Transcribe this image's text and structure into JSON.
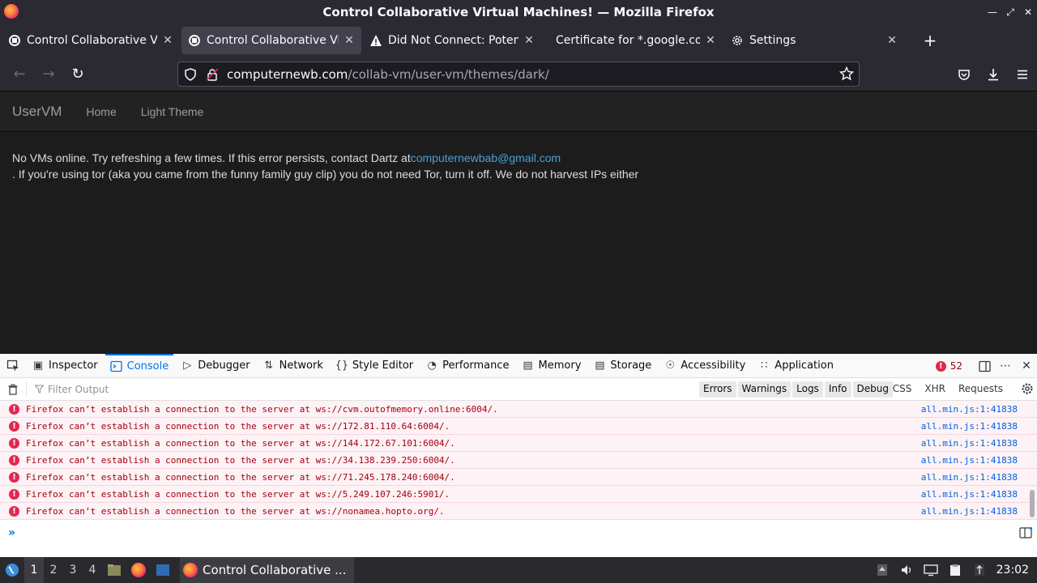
{
  "window": {
    "title": "Control Collaborative Virtual Machines! — Mozilla Firefox"
  },
  "tabs": [
    {
      "label": "Control Collaborative Virt",
      "icon": "vm-icon",
      "selected": false
    },
    {
      "label": "Control Collaborative Virt",
      "icon": "vm-icon",
      "selected": true
    },
    {
      "label": "Did Not Connect: Potenti",
      "icon": "warning-icon",
      "selected": false
    },
    {
      "label": "Certificate for *.google.com",
      "icon": "",
      "selected": false
    },
    {
      "label": "Settings",
      "icon": "gear-icon",
      "selected": false
    }
  ],
  "urlbar": {
    "domain": "computernewb.com",
    "path": "/collab-vm/user-vm/themes/dark/"
  },
  "site": {
    "brand": "UserVM",
    "nav": [
      "Home",
      "Light Theme"
    ],
    "message_before": "No VMs online. Try refreshing a few times. If this error persists, contact Dartz at",
    "email": "computernewbab@gmail.com",
    "message_after": ". If you're using tor (aka you came from the funny family guy clip) you do not need Tor, turn it off. We do not harvest IPs either"
  },
  "devtools": {
    "tabs": [
      {
        "label": "Inspector",
        "icon": "inspector-icon",
        "selected": false
      },
      {
        "label": "Console",
        "icon": "console-icon",
        "selected": true
      },
      {
        "label": "Debugger",
        "icon": "debugger-icon",
        "selected": false
      },
      {
        "label": "Network",
        "icon": "network-icon",
        "selected": false
      },
      {
        "label": "Style Editor",
        "icon": "style-editor-icon",
        "selected": false
      },
      {
        "label": "Performance",
        "icon": "performance-icon",
        "selected": false
      },
      {
        "label": "Memory",
        "icon": "memory-icon",
        "selected": false
      },
      {
        "label": "Storage",
        "icon": "storage-icon",
        "selected": false
      },
      {
        "label": "Accessibility",
        "icon": "accessibility-icon",
        "selected": false
      },
      {
        "label": "Application",
        "icon": "application-icon",
        "selected": false
      }
    ],
    "error_count": "52",
    "filter_placeholder": "Filter Output",
    "levels": [
      "Errors",
      "Warnings",
      "Logs",
      "Info",
      "Debug"
    ],
    "types": [
      "CSS",
      "XHR",
      "Requests"
    ],
    "log": [
      {
        "message": "Firefox can’t establish a connection to the server at ws://cvm.outofmemory.online:6004/.",
        "source": "all.min.js:1:41838"
      },
      {
        "message": "Firefox can’t establish a connection to the server at ws://172.81.110.64:6004/.",
        "source": "all.min.js:1:41838"
      },
      {
        "message": "Firefox can’t establish a connection to the server at ws://144.172.67.101:6004/.",
        "source": "all.min.js:1:41838"
      },
      {
        "message": "Firefox can’t establish a connection to the server at ws://34.138.239.250:6004/.",
        "source": "all.min.js:1:41838"
      },
      {
        "message": "Firefox can’t establish a connection to the server at ws://71.245.178.240:6004/.",
        "source": "all.min.js:1:41838"
      },
      {
        "message": "Firefox can’t establish a connection to the server at ws://5.249.107.246:5901/.",
        "source": "all.min.js:1:41838"
      },
      {
        "message": "Firefox can’t establish a connection to the server at ws://nonamea.hopto.org/.",
        "source": "all.min.js:1:41838"
      }
    ]
  },
  "taskbar": {
    "workspaces": [
      "1",
      "2",
      "3",
      "4"
    ],
    "active_workspace": "1",
    "task_label": "Control Collaborative ...",
    "clock": "23:02"
  }
}
